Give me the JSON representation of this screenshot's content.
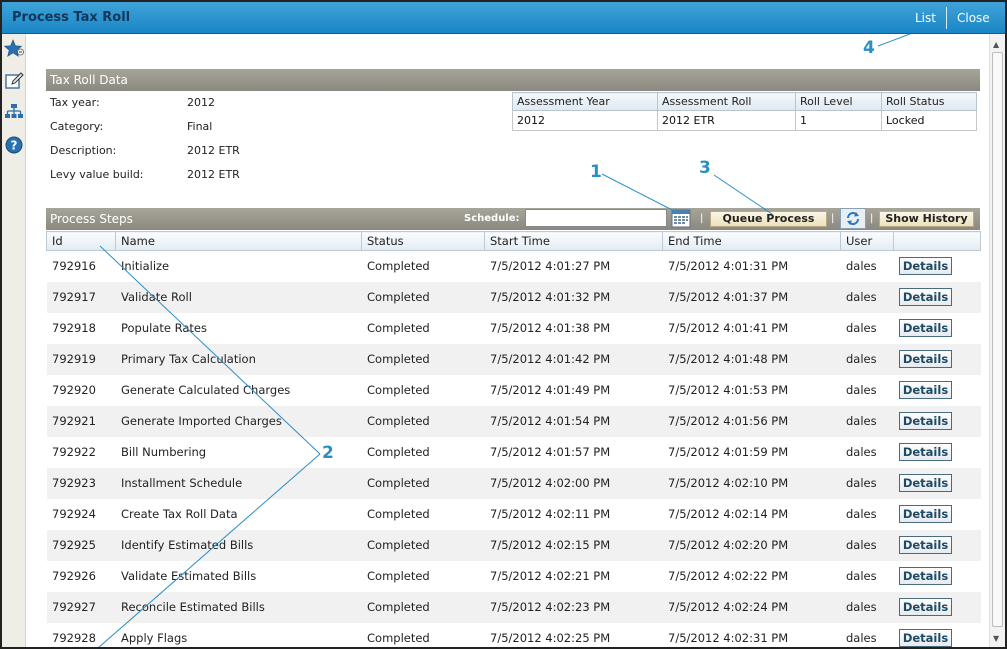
{
  "window": {
    "title": "Process Tax Roll",
    "list_label": "List",
    "close_label": "Close"
  },
  "sidebar": {
    "icons": [
      "favorites-star-icon",
      "edit-pencil-icon",
      "hierarchy-icon",
      "help-icon"
    ]
  },
  "tax_roll_data": {
    "header": "Tax Roll Data",
    "fields": [
      {
        "label": "Tax year:",
        "value": "2012"
      },
      {
        "label": "Category:",
        "value": "Final"
      },
      {
        "label": "Description:",
        "value": "2012 ETR"
      },
      {
        "label": "Levy value build:",
        "value": "2012 ETR"
      }
    ],
    "roll_table": {
      "columns": [
        "Assessment Year",
        "Assessment Roll",
        "Roll Level",
        "Roll Status"
      ],
      "rows": [
        [
          "2012",
          "2012 ETR",
          "1",
          "Locked"
        ]
      ]
    }
  },
  "process_steps": {
    "header": "Process Steps",
    "schedule_label": "Schedule:",
    "schedule_value": "",
    "queue_button": "Queue Process",
    "history_button": "Show History",
    "separator": "|",
    "columns": [
      "Id",
      "Name",
      "Status",
      "Start Time",
      "End Time",
      "User",
      ""
    ],
    "details_label": "Details",
    "rows": [
      {
        "id": "792916",
        "name": "Initialize",
        "status": "Completed",
        "start": "7/5/2012 4:01:27 PM",
        "end": "7/5/2012 4:01:31 PM",
        "user": "dales"
      },
      {
        "id": "792917",
        "name": "Validate Roll",
        "status": "Completed",
        "start": "7/5/2012 4:01:32 PM",
        "end": "7/5/2012 4:01:37 PM",
        "user": "dales"
      },
      {
        "id": "792918",
        "name": "Populate Rates",
        "status": "Completed",
        "start": "7/5/2012 4:01:38 PM",
        "end": "7/5/2012 4:01:41 PM",
        "user": "dales"
      },
      {
        "id": "792919",
        "name": "Primary Tax Calculation",
        "status": "Completed",
        "start": "7/5/2012 4:01:42 PM",
        "end": "7/5/2012 4:01:48 PM",
        "user": "dales"
      },
      {
        "id": "792920",
        "name": "Generate Calculated Charges",
        "status": "Completed",
        "start": "7/5/2012 4:01:49 PM",
        "end": "7/5/2012 4:01:53 PM",
        "user": "dales"
      },
      {
        "id": "792921",
        "name": "Generate Imported Charges",
        "status": "Completed",
        "start": "7/5/2012 4:01:54 PM",
        "end": "7/5/2012 4:01:56 PM",
        "user": "dales"
      },
      {
        "id": "792922",
        "name": "Bill Numbering",
        "status": "Completed",
        "start": "7/5/2012 4:01:57 PM",
        "end": "7/5/2012 4:01:59 PM",
        "user": "dales"
      },
      {
        "id": "792923",
        "name": "Installment Schedule",
        "status": "Completed",
        "start": "7/5/2012 4:02:00 PM",
        "end": "7/5/2012 4:02:10 PM",
        "user": "dales"
      },
      {
        "id": "792924",
        "name": "Create Tax Roll Data",
        "status": "Completed",
        "start": "7/5/2012 4:02:11 PM",
        "end": "7/5/2012 4:02:14 PM",
        "user": "dales"
      },
      {
        "id": "792925",
        "name": "Identify Estimated Bills",
        "status": "Completed",
        "start": "7/5/2012 4:02:15 PM",
        "end": "7/5/2012 4:02:20 PM",
        "user": "dales"
      },
      {
        "id": "792926",
        "name": "Validate Estimated Bills",
        "status": "Completed",
        "start": "7/5/2012 4:02:21 PM",
        "end": "7/5/2012 4:02:22 PM",
        "user": "dales"
      },
      {
        "id": "792927",
        "name": "Reconcile Estimated Bills",
        "status": "Completed",
        "start": "7/5/2012 4:02:23 PM",
        "end": "7/5/2012 4:02:24 PM",
        "user": "dales"
      },
      {
        "id": "792928",
        "name": "Apply Flags",
        "status": "Completed",
        "start": "7/5/2012 4:02:25 PM",
        "end": "7/5/2012 4:02:31 PM",
        "user": "dales"
      }
    ]
  },
  "callouts": [
    "1",
    "2",
    "3",
    "4"
  ],
  "colors": {
    "titlebar": "#1a86c6",
    "section_header": "#8b897f",
    "callout": "#2b8ec6",
    "button_beige": "#ede0bd"
  }
}
